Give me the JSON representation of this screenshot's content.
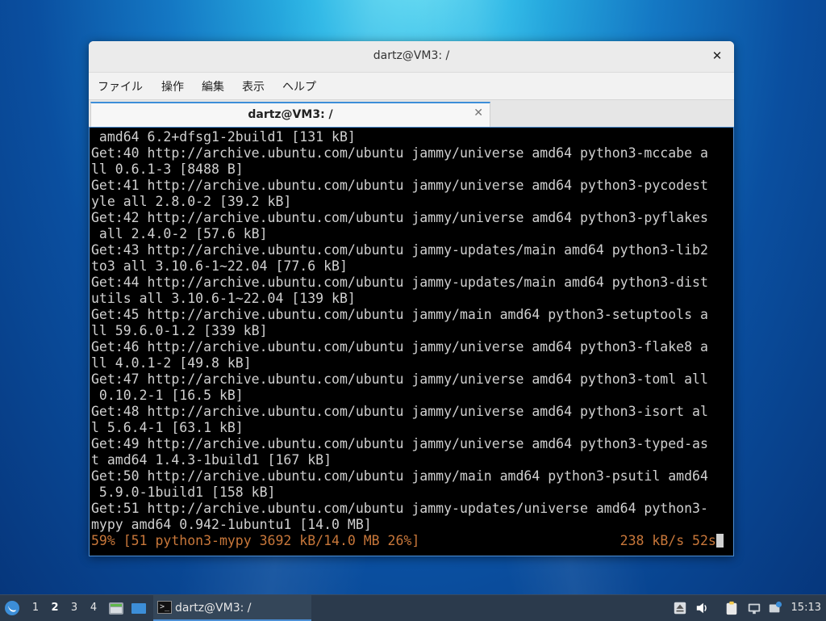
{
  "window": {
    "title": "dartz@VM3: /",
    "close_glyph": "✕"
  },
  "menu": [
    "ファイル",
    "操作",
    "編集",
    "表示",
    "ヘルプ"
  ],
  "tab": {
    "label": "dartz@VM3: /",
    "close_glyph": "✕"
  },
  "terminal": {
    "lines": [
      " amd64 6.2+dfsg1-2build1 [131 kB]",
      "Get:40 http://archive.ubuntu.com/ubuntu jammy/universe amd64 python3-mccabe a",
      "ll 0.6.1-3 [8488 B]",
      "Get:41 http://archive.ubuntu.com/ubuntu jammy/universe amd64 python3-pycodest",
      "yle all 2.8.0-2 [39.2 kB]",
      "Get:42 http://archive.ubuntu.com/ubuntu jammy/universe amd64 python3-pyflakes",
      " all 2.4.0-2 [57.6 kB]",
      "Get:43 http://archive.ubuntu.com/ubuntu jammy-updates/main amd64 python3-lib2",
      "to3 all 3.10.6-1~22.04 [77.6 kB]",
      "Get:44 http://archive.ubuntu.com/ubuntu jammy-updates/main amd64 python3-dist",
      "utils all 3.10.6-1~22.04 [139 kB]",
      "Get:45 http://archive.ubuntu.com/ubuntu jammy/main amd64 python3-setuptools a",
      "ll 59.6.0-1.2 [339 kB]",
      "Get:46 http://archive.ubuntu.com/ubuntu jammy/universe amd64 python3-flake8 a",
      "ll 4.0.1-2 [49.8 kB]",
      "Get:47 http://archive.ubuntu.com/ubuntu jammy/universe amd64 python3-toml all",
      " 0.10.2-1 [16.5 kB]",
      "Get:48 http://archive.ubuntu.com/ubuntu jammy/universe amd64 python3-isort al",
      "l 5.6.4-1 [63.1 kB]",
      "Get:49 http://archive.ubuntu.com/ubuntu jammy/universe amd64 python3-typed-as",
      "t amd64 1.4.3-1build1 [167 kB]",
      "Get:50 http://archive.ubuntu.com/ubuntu jammy/main amd64 python3-psutil amd64",
      " 5.9.0-1build1 [158 kB]",
      "Get:51 http://archive.ubuntu.com/ubuntu jammy-updates/universe amd64 python3-",
      "mypy amd64 0.942-1ubuntu1 [14.0 MB]"
    ],
    "status_left": "59% [51 python3-mypy 3692 kB/14.0 MB 26%]",
    "status_right": "238 kB/s 52s"
  },
  "taskbar": {
    "start_icon": "lubuntu-start-icon",
    "workspaces": [
      "1",
      "2",
      "3",
      "4"
    ],
    "active_workspace": "2",
    "app_label": "dartz@VM3: /",
    "clock": "15:13",
    "colors": {
      "bar": "#2b3a4c",
      "accent": "#4c8fd6",
      "status_text": "#c8773a"
    }
  }
}
